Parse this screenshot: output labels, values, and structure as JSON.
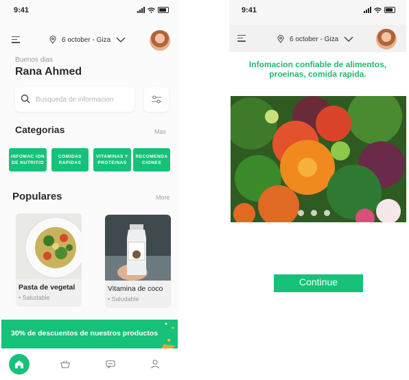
{
  "left_screen": {
    "status_time": "9:41",
    "location": "6 october - Giza",
    "greeting": "Buenos dias",
    "user_name": "Rana Ahmed",
    "search": {
      "placeholder": "Busqueda de informacion"
    },
    "categories": {
      "title": "Categorias",
      "more": "Mas",
      "items": [
        {
          "label": "INFOMAC ION DE NUTRITIO"
        },
        {
          "label": "COMIDAS RAPIDAS"
        },
        {
          "label": "VITAMINAS Y PROTEINAS"
        },
        {
          "label": "RECOMENDA CIONES"
        }
      ]
    },
    "popular": {
      "title": "Populares",
      "more": "More",
      "cards": [
        {
          "title": "Pasta de vegetal",
          "subtitle": "• Saludable"
        },
        {
          "title": "Vitamina de coco",
          "subtitle": "• Saludable"
        }
      ]
    },
    "promo_text": "30% de descuentos de nuestros productos",
    "tabs": [
      {
        "icon": "home-icon"
      },
      {
        "icon": "basket-icon"
      },
      {
        "icon": "chat-icon"
      },
      {
        "icon": "profile-icon"
      }
    ]
  },
  "right_screen": {
    "status_time": "9:41",
    "location": "6 october - Giza",
    "info_title": "Infomacion confiable de alimentos, proeinas, comida rapida.",
    "continue_label": "Continue"
  },
  "colors": {
    "accent": "#17c17a",
    "info_title": "#21b86f"
  }
}
